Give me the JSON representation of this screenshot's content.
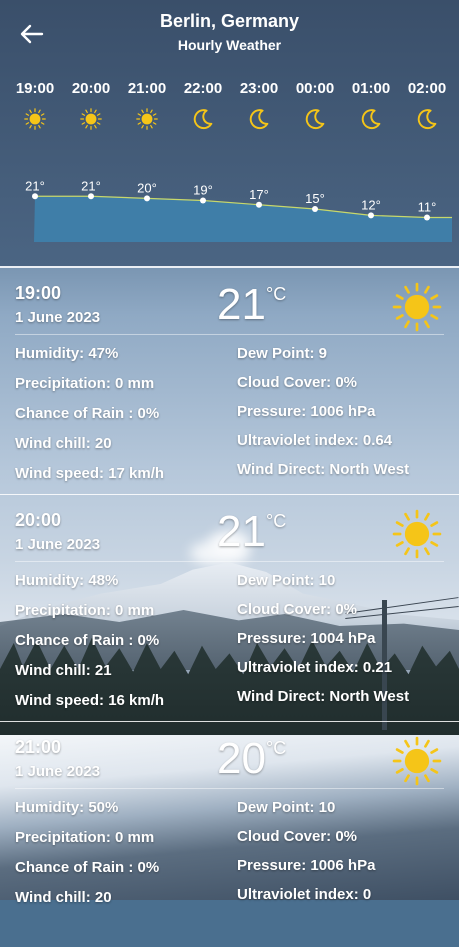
{
  "header": {
    "city": "Berlin, Germany",
    "subtitle": "Hourly Weather",
    "back_icon": "arrow-left-icon"
  },
  "hourly": [
    {
      "time": "19:00",
      "icon": "sun-icon",
      "temp": "21°"
    },
    {
      "time": "20:00",
      "icon": "sun-icon",
      "temp": "21°"
    },
    {
      "time": "21:00",
      "icon": "sun-icon",
      "temp": "20°"
    },
    {
      "time": "22:00",
      "icon": "moon-icon",
      "temp": "19°"
    },
    {
      "time": "23:00",
      "icon": "moon-icon",
      "temp": "17°"
    },
    {
      "time": "00:00",
      "icon": "moon-icon",
      "temp": "15°"
    },
    {
      "time": "01:00",
      "icon": "moon-icon",
      "temp": "12°"
    },
    {
      "time": "02:00",
      "icon": "moon-icon",
      "temp": "11°"
    }
  ],
  "chart_data": {
    "type": "area",
    "x": [
      "19:00",
      "20:00",
      "21:00",
      "22:00",
      "23:00",
      "00:00",
      "01:00",
      "02:00"
    ],
    "values": [
      21,
      21,
      20,
      19,
      17,
      15,
      12,
      11
    ],
    "ylim": [
      7,
      23
    ],
    "fill_color": "#3f7ea8",
    "line_color": "#c8d86a"
  },
  "cards": [
    {
      "time": "19:00",
      "date": "1 June 2023",
      "temp": "21",
      "unit": "°C",
      "icon": "sun-icon",
      "humidity": "Humidity: 47%",
      "precipitation": "Precipitation: 0 mm",
      "rain_chance": "Chance of Rain : 0%",
      "wind_chill": "Wind chill: 20",
      "wind_speed": "Wind speed: 17 km/h",
      "dew_point": "Dew Point: 9",
      "cloud_cover": "Cloud Cover: 0%",
      "pressure": "Pressure: 1006 hPa",
      "uv": "Ultraviolet index: 0.64",
      "wind_dir": "Wind Direct: North West"
    },
    {
      "time": "20:00",
      "date": "1 June 2023",
      "temp": "21",
      "unit": "°C",
      "icon": "sun-icon",
      "humidity": "Humidity: 48%",
      "precipitation": "Precipitation: 0 mm",
      "rain_chance": "Chance of Rain : 0%",
      "wind_chill": "Wind chill: 21",
      "wind_speed": "Wind speed: 16 km/h",
      "dew_point": "Dew Point: 10",
      "cloud_cover": "Cloud Cover: 0%",
      "pressure": "Pressure: 1004 hPa",
      "uv": "Ultraviolet index: 0.21",
      "wind_dir": "Wind Direct: North West"
    },
    {
      "time": "21:00",
      "date": "1 June 2023",
      "temp": "20",
      "unit": "°C",
      "icon": "sun-icon",
      "humidity": "Humidity: 50%",
      "precipitation": "Precipitation: 0 mm",
      "rain_chance": "Chance of Rain : 0%",
      "wind_chill": "Wind chill: 20",
      "wind_speed": "",
      "dew_point": "Dew Point: 10",
      "cloud_cover": "Cloud Cover: 0%",
      "pressure": "Pressure: 1006 hPa",
      "uv": "Ultraviolet index: 0",
      "wind_dir": ""
    }
  ],
  "colors": {
    "sun": "#f5c518",
    "moon": "#f5c518",
    "header_bg": "#3a4f6a"
  }
}
